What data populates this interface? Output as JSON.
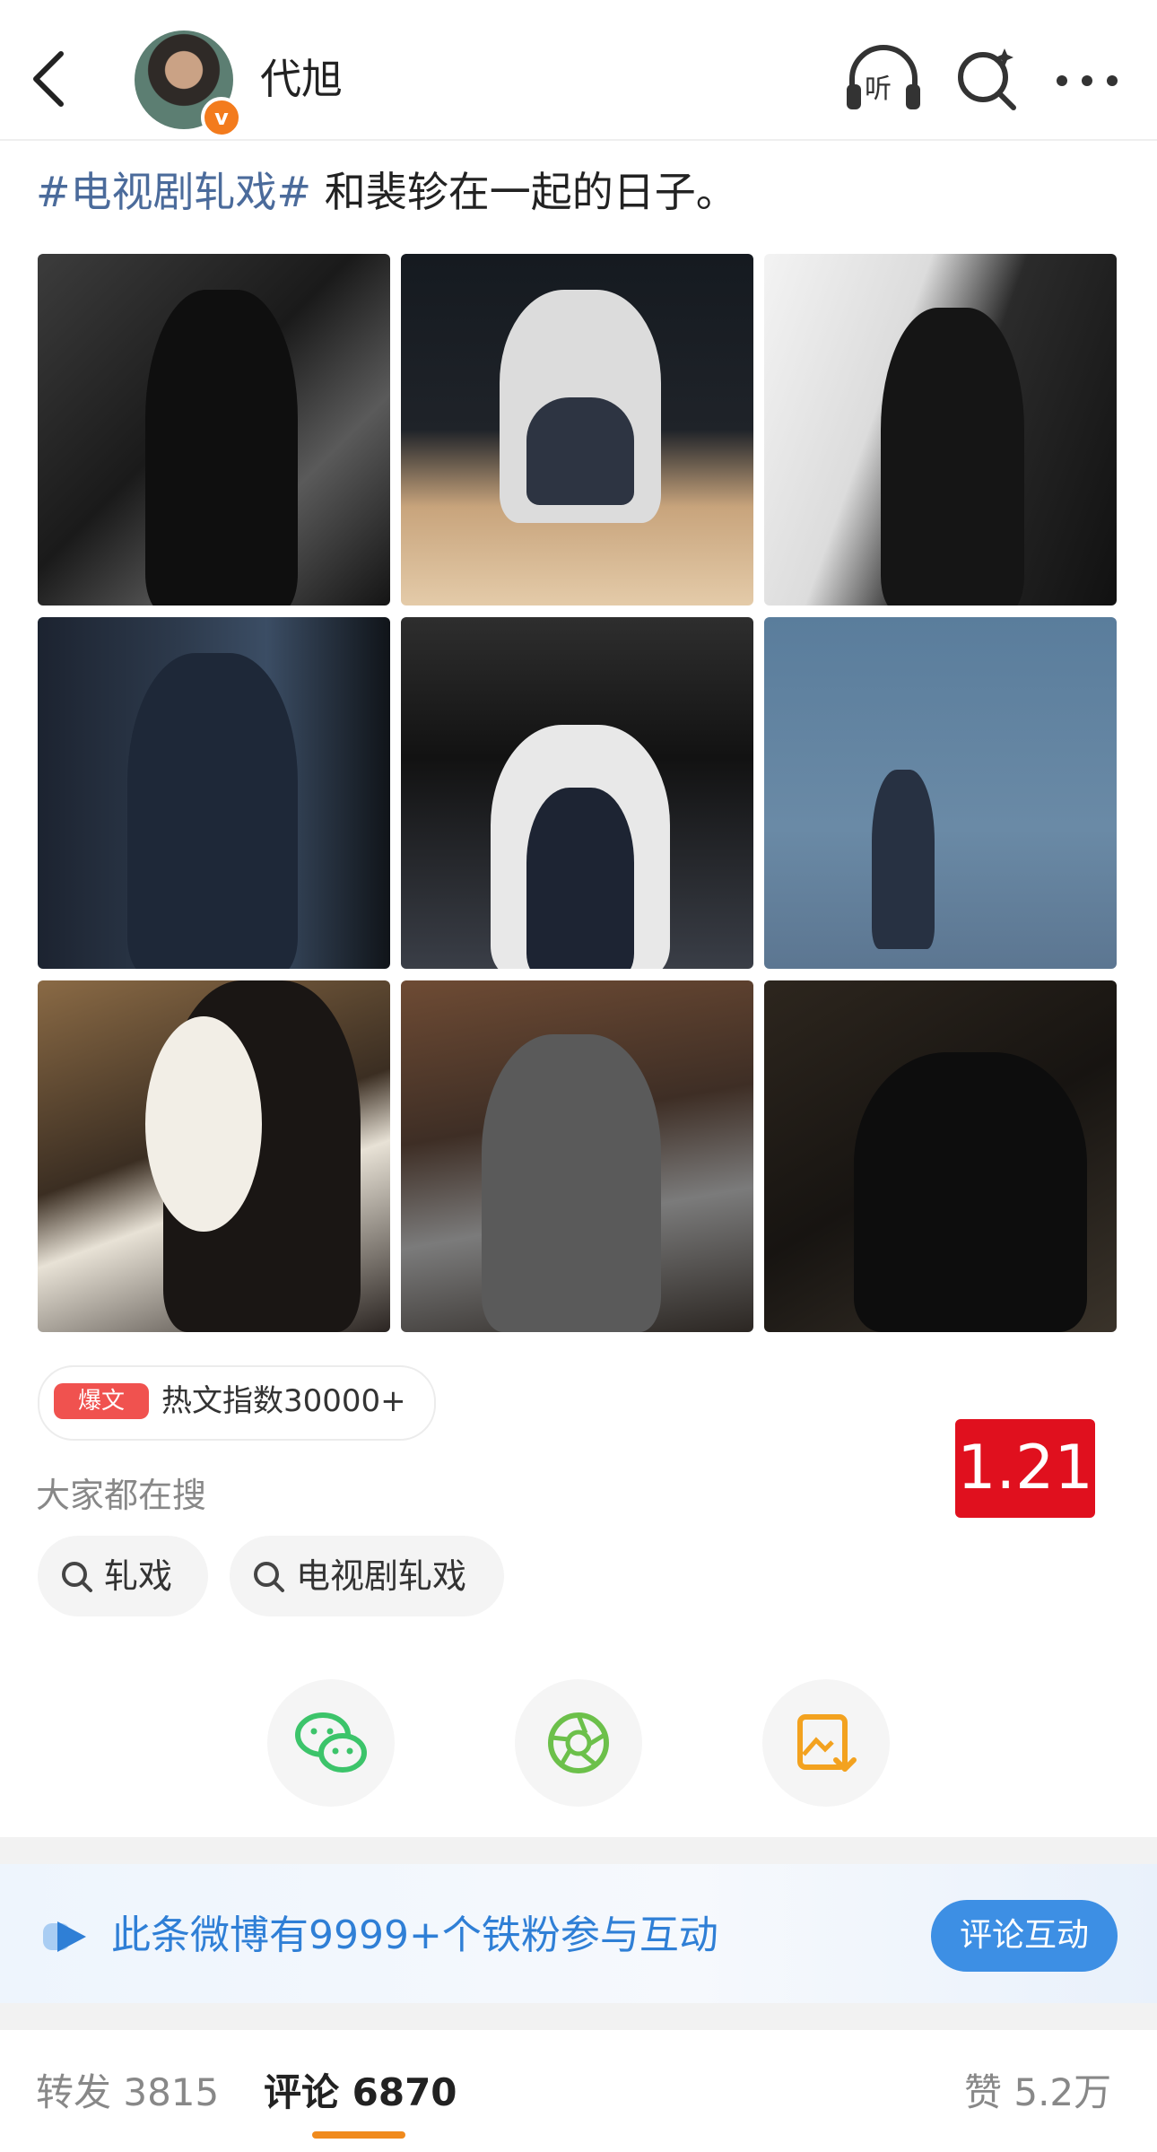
{
  "header": {
    "username": "代旭",
    "listen_label": "听"
  },
  "post": {
    "topic": "#电视剧轧戏#",
    "text": " 和裴轸在一起的日子。"
  },
  "hot": {
    "badge": "爆文",
    "text": "热文指数30000+"
  },
  "date_stamp": "1.21",
  "search_section": {
    "label": "大家都在搜",
    "chips": [
      "轧戏",
      "电视剧轧戏"
    ]
  },
  "fan_banner": {
    "text": "此条微博有9999+个铁粉参与互动",
    "button": "评论互动"
  },
  "tabs": {
    "forward": "转发 3815",
    "comment": "评论 6870",
    "like": "赞 5.2万"
  },
  "colors": {
    "topic": "#4b6b9b",
    "hot_badge": "#f0524f",
    "date_stamp": "#e0101e",
    "fan_text": "#2f7fd6",
    "fan_button": "#3d8fe4",
    "tab_underline": "#f08a1c",
    "wechat": "#3cc46a",
    "moments": "#6cc04a",
    "save": "#f3a21f"
  }
}
